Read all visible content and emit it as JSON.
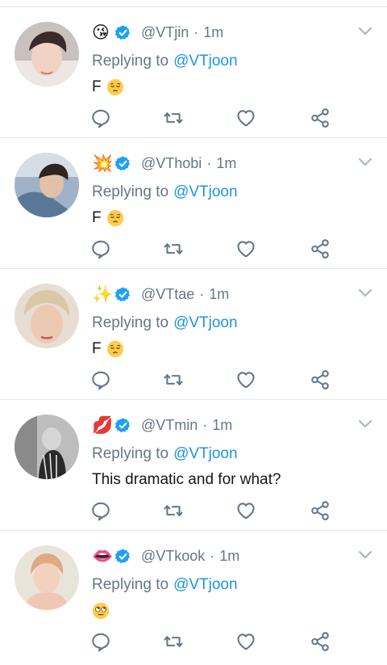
{
  "colors": {
    "text": "#14171a",
    "secondary": "#657786",
    "link": "#1b95e0",
    "verified": "#1da1f2",
    "divider": "#e1e8ed"
  },
  "icons": {
    "reply": "speech-bubble-icon",
    "retweet": "retweet-arrows-icon",
    "like": "heart-outline-icon",
    "share": "share-nodes-icon",
    "more": "chevron-down-icon",
    "verified": "verified-badge-icon"
  },
  "tweets": [
    {
      "name_emoji": "😘",
      "handle": "@VTjin",
      "separator": "·",
      "time": "1m",
      "replying_label": "Replying to",
      "replying_to": "@VTjoon",
      "text": "F",
      "text_emoji": "pensive-face"
    },
    {
      "name_emoji": "💥",
      "handle": "@VThobi",
      "separator": "·",
      "time": "1m",
      "replying_label": "Replying to",
      "replying_to": "@VTjoon",
      "text": "F",
      "text_emoji": "pensive-face"
    },
    {
      "name_emoji": "✨",
      "handle": "@VTtae",
      "separator": "·",
      "time": "1m",
      "replying_label": "Replying to",
      "replying_to": "@VTjoon",
      "text": "F",
      "text_emoji": "pensive-face"
    },
    {
      "name_emoji": "💋",
      "handle": "@VTmin",
      "separator": "·",
      "time": "1m",
      "replying_label": "Replying to",
      "replying_to": "@VTjoon",
      "text": "This dramatic and for what?",
      "text_emoji": ""
    },
    {
      "name_emoji": "👄",
      "handle": "@VTkook",
      "separator": "·",
      "time": "1m",
      "replying_label": "Replying to",
      "replying_to": "@VTjoon",
      "text": "",
      "text_emoji": "face-with-rolling-eyes"
    }
  ]
}
